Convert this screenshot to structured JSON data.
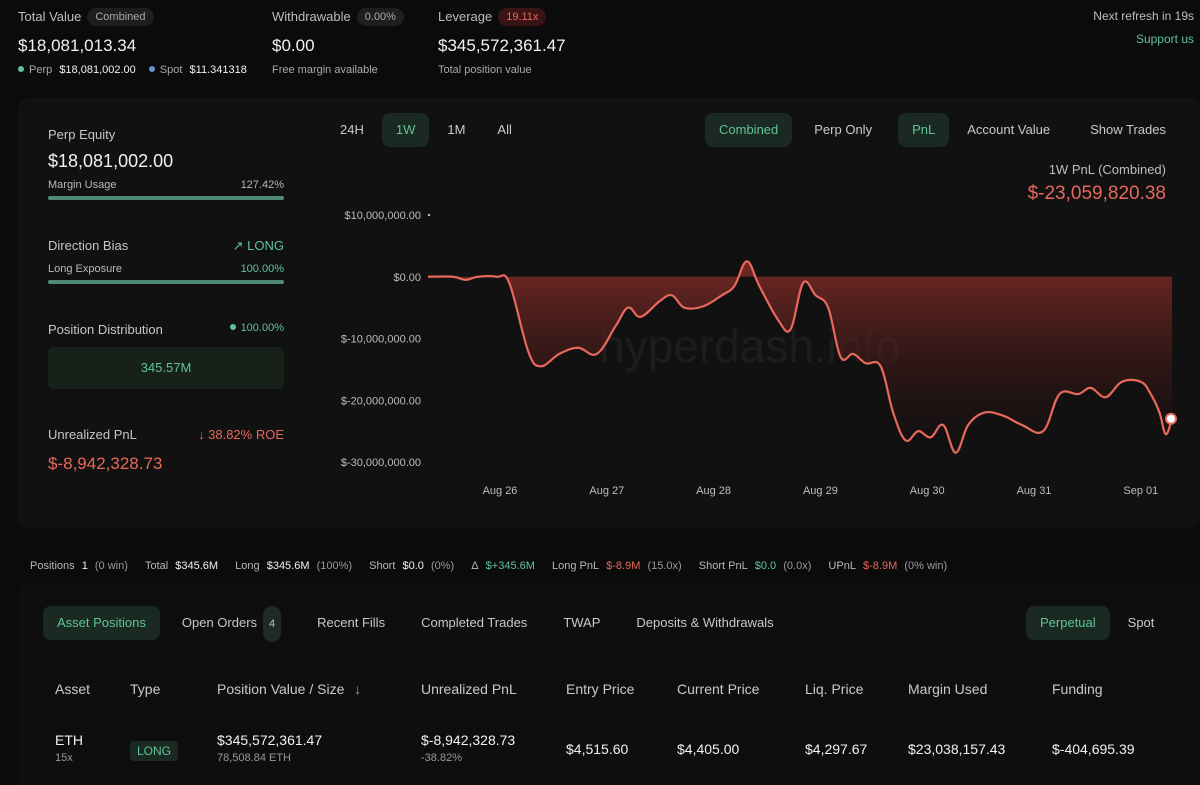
{
  "header": {
    "total_value": {
      "label": "Total Value",
      "pill": "Combined",
      "value": "$18,081,013.34",
      "perp_label": "Perp",
      "perp_value": "$18,081,002.00",
      "spot_label": "Spot",
      "spot_value": "$11.341318"
    },
    "withdrawable": {
      "label": "Withdrawable",
      "pill": "0.00%",
      "value": "$0.00",
      "sub": "Free margin available"
    },
    "leverage": {
      "label": "Leverage",
      "pill": "19.11x",
      "value": "$345,572,361.47",
      "sub": "Total position value"
    },
    "refresh": "Next refresh in 19s",
    "support": "Support us"
  },
  "left": {
    "perp_equity_label": "Perp Equity",
    "perp_equity_value": "$18,081,002.00",
    "margin_usage_label": "Margin Usage",
    "margin_usage_value": "127.42%",
    "margin_usage_fill": 1.0,
    "direction_label": "Direction Bias",
    "direction_value": "LONG",
    "long_exposure_label": "Long Exposure",
    "long_exposure_value": "100.00%",
    "long_exposure_fill": 1.0,
    "position_dist_label": "Position Distribution",
    "position_dist_value": "100.00%",
    "position_dist_box": "345.57M",
    "upnl_label": "Unrealized PnL",
    "upnl_roe": "38.82% ROE",
    "upnl_value": "$-8,942,328.73"
  },
  "chart_controls": {
    "ranges": [
      "24H",
      "1W",
      "1M",
      "All"
    ],
    "active_range": "1W",
    "mode_combined": "Combined",
    "mode_perp": "Perp Only",
    "metric_pnl": "PnL",
    "metric_account": "Account Value",
    "show_trades": "Show Trades",
    "pnl_title": "1W PnL (Combined)",
    "pnl_value": "$-23,059,820.38"
  },
  "chart_data": {
    "type": "area",
    "y_ticks": [
      "$10,000,000.00",
      "$0.00",
      "$-10,000,000.00",
      "$-20,000,000.00",
      "$-30,000,000.00"
    ],
    "x_ticks": [
      "Aug 26",
      "Aug 27",
      "Aug 28",
      "Aug 29",
      "Aug 30",
      "Aug 31",
      "Sep 01"
    ],
    "ylim": [
      -30000000,
      10000000
    ],
    "watermark": "hyperdash.info",
    "colors": {
      "line": "#e8685c",
      "fill_top": "#7a2a26",
      "fill_bottom": "#1a0f0f"
    },
    "series": [
      {
        "values": [
          [
            0,
            0
          ],
          [
            0.2,
            0
          ],
          [
            0.3,
            -500000
          ],
          [
            0.4,
            0
          ],
          [
            0.55,
            0
          ],
          [
            0.65,
            -1000000
          ],
          [
            0.8,
            -12000000
          ],
          [
            0.9,
            -14500000
          ],
          [
            1.05,
            -12500000
          ],
          [
            1.2,
            -11500000
          ],
          [
            1.35,
            -12500000
          ],
          [
            1.5,
            -8000000
          ],
          [
            1.6,
            -5000000
          ],
          [
            1.7,
            -6500000
          ],
          [
            1.85,
            -4000000
          ],
          [
            1.95,
            -3000000
          ],
          [
            2.05,
            -5000000
          ],
          [
            2.2,
            -4800000
          ],
          [
            2.35,
            -3000000
          ],
          [
            2.45,
            -1500000
          ],
          [
            2.55,
            2500000
          ],
          [
            2.65,
            -1500000
          ],
          [
            2.8,
            -7000000
          ],
          [
            2.9,
            -8500000
          ],
          [
            3.0,
            -1000000
          ],
          [
            3.1,
            -3000000
          ],
          [
            3.2,
            -5000000
          ],
          [
            3.3,
            -13000000
          ],
          [
            3.4,
            -12500000
          ],
          [
            3.5,
            -14000000
          ],
          [
            3.62,
            -14500000
          ],
          [
            3.72,
            -22000000
          ],
          [
            3.82,
            -26500000
          ],
          [
            3.92,
            -25000000
          ],
          [
            4.02,
            -26000000
          ],
          [
            4.12,
            -24000000
          ],
          [
            4.22,
            -28500000
          ],
          [
            4.32,
            -24000000
          ],
          [
            4.45,
            -22000000
          ],
          [
            4.6,
            -22500000
          ],
          [
            4.75,
            -24000000
          ],
          [
            4.92,
            -25000000
          ],
          [
            5.05,
            -19000000
          ],
          [
            5.2,
            -19000000
          ],
          [
            5.3,
            -18000000
          ],
          [
            5.42,
            -19500000
          ],
          [
            5.55,
            -17000000
          ],
          [
            5.7,
            -17000000
          ],
          [
            5.78,
            -19000000
          ],
          [
            5.85,
            -22000000
          ],
          [
            5.9,
            -25500000
          ],
          [
            5.95,
            -23000000
          ]
        ]
      }
    ]
  },
  "stats": {
    "positions_label": "Positions",
    "positions_value": "1",
    "positions_win": "(0 win)",
    "total_label": "Total",
    "total_value": "$345.6M",
    "long_label": "Long",
    "long_value": "$345.6M",
    "long_pct": "(100%)",
    "short_label": "Short",
    "short_value": "$0.0",
    "short_pct": "(0%)",
    "delta_label": "Δ",
    "delta_value": "$+345.6M",
    "longpnl_label": "Long PnL",
    "longpnl_value": "$-8.9M",
    "longpnl_x": "(15.0x)",
    "shortpnl_label": "Short PnL",
    "shortpnl_value": "$0.0",
    "shortpnl_x": "(0.0x)",
    "upnl_label": "UPnL",
    "upnl_value": "$-8.9M",
    "upnl_win": "(0% win)"
  },
  "tabs": {
    "asset_positions": "Asset Positions",
    "open_orders": "Open Orders",
    "open_orders_count": "4",
    "recent_fills": "Recent Fills",
    "completed_trades": "Completed Trades",
    "twap": "TWAP",
    "deposits": "Deposits & Withdrawals",
    "perpetual": "Perpetual",
    "spot": "Spot"
  },
  "table": {
    "headers": [
      "Asset",
      "Type",
      "Position Value / Size",
      "Unrealized PnL",
      "Entry Price",
      "Current Price",
      "Liq. Price",
      "Margin Used",
      "Funding"
    ],
    "rows": [
      {
        "asset": "ETH",
        "leverage": "15x",
        "type": "LONG",
        "position_value": "$345,572,361.47",
        "size": "78,508.84 ETH",
        "upnl": "$-8,942,328.73",
        "upnl_pct": "-38.82%",
        "entry": "$4,515.60",
        "current": "$4,405.00",
        "liq": "$4,297.67",
        "margin": "$23,038,157.43",
        "funding": "$-404,695.39"
      }
    ]
  }
}
